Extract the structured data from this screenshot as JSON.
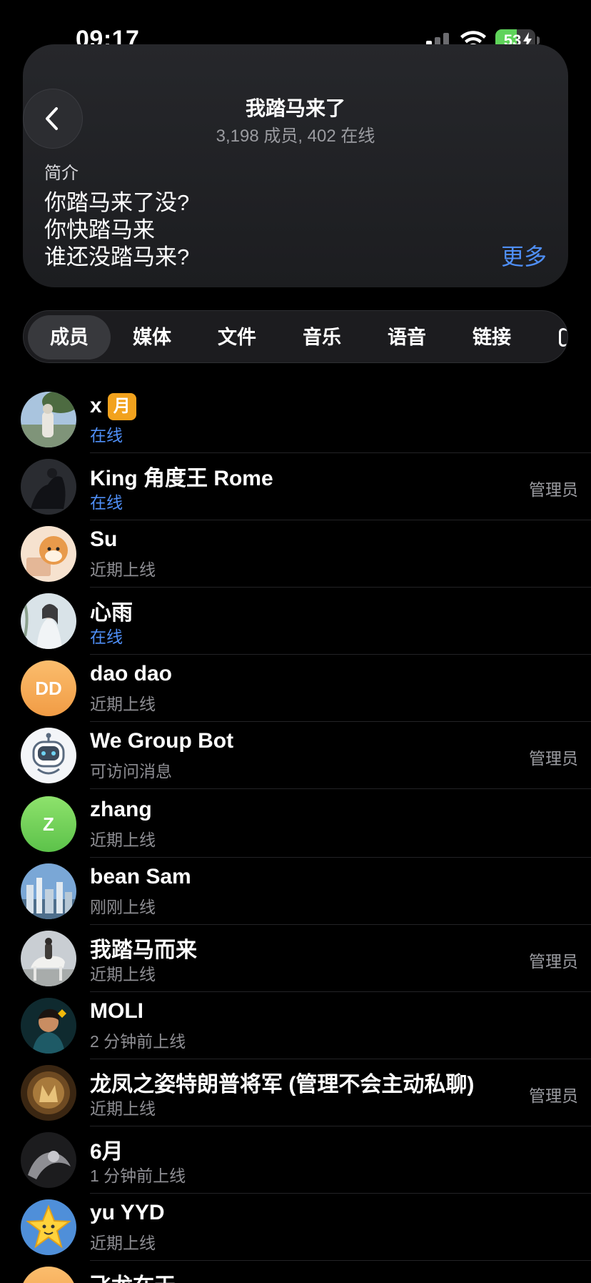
{
  "status_bar": {
    "time": "09:17",
    "battery": "53",
    "battery_level": 0.53
  },
  "header": {
    "title": "我踏马来了",
    "subtitle": "3,198 成员, 402 在线",
    "bio_label": "简介",
    "bio_lines": [
      "你踏马来了没?",
      "你快踏马来",
      "谁还没踏马来?"
    ],
    "more": "更多"
  },
  "tabs": [
    {
      "label": "成员",
      "active": true
    },
    {
      "label": "媒体"
    },
    {
      "label": "文件"
    },
    {
      "label": "音乐"
    },
    {
      "label": "语音"
    },
    {
      "label": "链接"
    }
  ],
  "members": [
    {
      "name": "x",
      "badge": "月",
      "status": "在线",
      "online": true,
      "role": ""
    },
    {
      "name": "King 角度王 Rome",
      "status": "在线",
      "online": true,
      "role": "管理员"
    },
    {
      "name": "Su",
      "status": "近期上线",
      "online": false,
      "role": ""
    },
    {
      "name": "心雨",
      "status": "在线",
      "online": true,
      "role": ""
    },
    {
      "name": "dao dao",
      "status": "近期上线",
      "online": false,
      "role": "",
      "initials": "DD"
    },
    {
      "name": "We Group Bot",
      "status": "可访问消息",
      "online": false,
      "role": "管理员"
    },
    {
      "name": "zhang",
      "status": "近期上线",
      "online": false,
      "role": "",
      "initials": "Z"
    },
    {
      "name": "bean Sam",
      "status": "刚刚上线",
      "online": false,
      "role": ""
    },
    {
      "name": "我踏马而来",
      "status": "近期上线",
      "online": false,
      "role": "管理员"
    },
    {
      "name": "MOLI",
      "status": "2 分钟前上线",
      "online": false,
      "role": ""
    },
    {
      "name": "龙凤之姿特朗普将军 (管理不会主动私聊)",
      "status": "近期上线",
      "online": false,
      "role": "管理员"
    },
    {
      "name": "6月",
      "status": "1 分钟前上线",
      "online": false,
      "role": ""
    },
    {
      "name": "yu YYD",
      "status": "近期上线",
      "online": false,
      "role": ""
    },
    {
      "name": "飞龙在天",
      "status": "",
      "online": false,
      "role": ""
    }
  ]
}
